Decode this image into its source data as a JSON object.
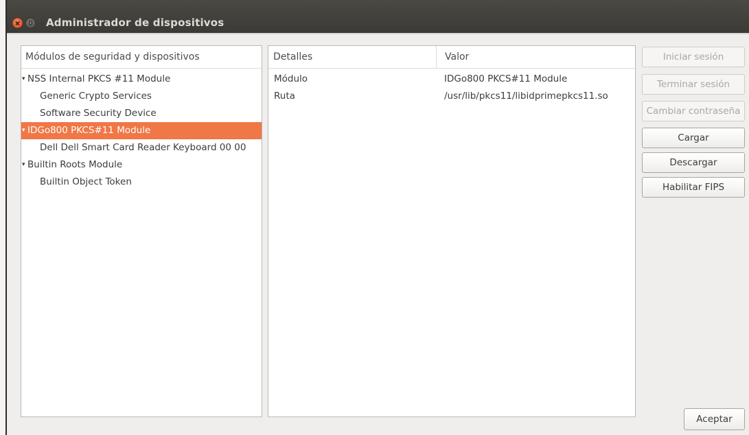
{
  "window": {
    "title": "Administrador de dispositivos"
  },
  "modules_panel": {
    "header": "Módulos de seguridad y dispositivos",
    "rows": [
      {
        "label": "NSS Internal PKCS #11 Module",
        "level": 0,
        "expanded": true,
        "selected": false
      },
      {
        "label": "Generic Crypto Services",
        "level": 1,
        "selected": false
      },
      {
        "label": "Software Security Device",
        "level": 1,
        "selected": false
      },
      {
        "label": "IDGo800 PKCS#11 Module",
        "level": 0,
        "expanded": true,
        "selected": true
      },
      {
        "label": "Dell Dell Smart Card Reader Keyboard 00 00",
        "level": 1,
        "selected": false
      },
      {
        "label": "Builtin Roots Module",
        "level": 0,
        "expanded": true,
        "selected": false
      },
      {
        "label": "Builtin Object Token",
        "level": 1,
        "selected": false
      }
    ]
  },
  "details_panel": {
    "header_details": "Detalles",
    "header_value": "Valor",
    "rows": [
      {
        "label": "Módulo",
        "value": "IDGo800 PKCS#11 Module"
      },
      {
        "label": "Ruta",
        "value": "/usr/lib/pkcs11/libidprimepkcs11.so"
      }
    ]
  },
  "actions": {
    "login": {
      "label": "Iniciar sesión",
      "enabled": false
    },
    "logout": {
      "label": "Terminar sesión",
      "enabled": false
    },
    "change_password": {
      "label": "Cambiar contraseña",
      "enabled": false
    },
    "load": {
      "label": "Cargar",
      "enabled": true
    },
    "unload": {
      "label": "Descargar",
      "enabled": true
    },
    "enable_fips": {
      "label": "Habilitar FIPS",
      "enabled": true
    }
  },
  "footer": {
    "ok_label": "Aceptar"
  },
  "colors": {
    "selection": "#f07746",
    "titlebar": "#3f3e3a",
    "window_bg": "#efeeec"
  },
  "icons": {
    "expanded_marker": "▾"
  }
}
